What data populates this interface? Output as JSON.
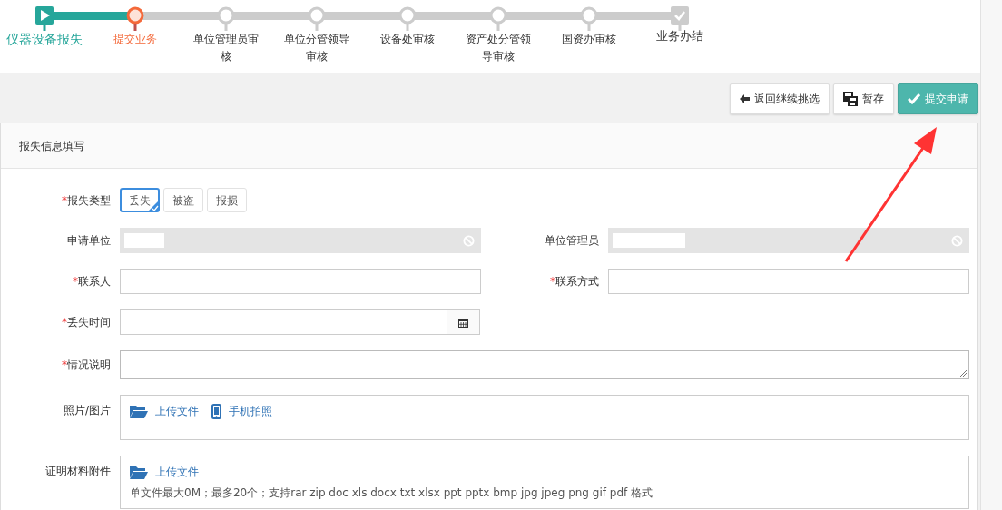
{
  "steps": [
    {
      "label": "仪器设备报失",
      "kind": "start",
      "completed": true,
      "selected": false
    },
    {
      "label": "提交业务",
      "kind": "node",
      "completed": false,
      "selected": true
    },
    {
      "label": "单位管理员审核",
      "kind": "node",
      "completed": false,
      "selected": false
    },
    {
      "label": "单位分管领导审核",
      "kind": "node",
      "completed": false,
      "selected": false
    },
    {
      "label": "设备处审核",
      "kind": "node",
      "completed": false,
      "selected": false
    },
    {
      "label": "资产处分管领导审核",
      "kind": "node",
      "completed": false,
      "selected": false
    },
    {
      "label": "国资办审核",
      "kind": "node",
      "completed": false,
      "selected": false
    },
    {
      "label": "业务办结",
      "kind": "end",
      "completed": false,
      "selected": false
    }
  ],
  "toolbar": [
    {
      "label": "返回继续挑选",
      "kind": "back"
    },
    {
      "label": "暂存",
      "kind": "save"
    },
    {
      "label": "提交申请",
      "kind": "submit"
    }
  ],
  "panel": {
    "title": "报失信息填写",
    "rows": [
      {
        "fields": [
          {
            "label": "报失类型",
            "marker": "*",
            "kind": "choice",
            "options": [
              {
                "label": "丢失",
                "selected": true
              },
              {
                "label": "被盗",
                "selected": false
              },
              {
                "label": "报损",
                "selected": false
              }
            ]
          }
        ]
      },
      {
        "fields": [
          {
            "label": "申请单位",
            "kind": "text",
            "disabled": true,
            "masked": true
          },
          {
            "label": "单位管理员",
            "kind": "text",
            "disabled": true,
            "masked": true
          }
        ]
      },
      {
        "fields": [
          {
            "label": "联系人",
            "marker": "*",
            "kind": "text",
            "disabled": false
          },
          {
            "label": "联系方式",
            "marker": "*",
            "kind": "text",
            "disabled": false
          }
        ]
      },
      {
        "fields": [
          {
            "label": "丢失时间",
            "marker": "*",
            "kind": "date"
          }
        ]
      },
      {
        "fields": [
          {
            "label": "情况说明",
            "marker": "*",
            "kind": "textarea"
          }
        ]
      },
      {
        "fields": [
          {
            "label": "照片/图片",
            "kind": "upload",
            "actions": [
              {
                "label": "上传文件",
                "kind": "folder"
              },
              {
                "label": "手机拍照",
                "kind": "phone"
              }
            ]
          }
        ]
      },
      {
        "fields": [
          {
            "label": "证明材料附件",
            "kind": "upload",
            "actions": [
              {
                "label": "上传文件",
                "kind": "folder"
              }
            ],
            "hint": "单文件最大0M；最多20个；支持rar zip doc xls docx txt xlsx ppt pptx bmp jpg jpeg png gif pdf 格式"
          }
        ]
      }
    ]
  }
}
